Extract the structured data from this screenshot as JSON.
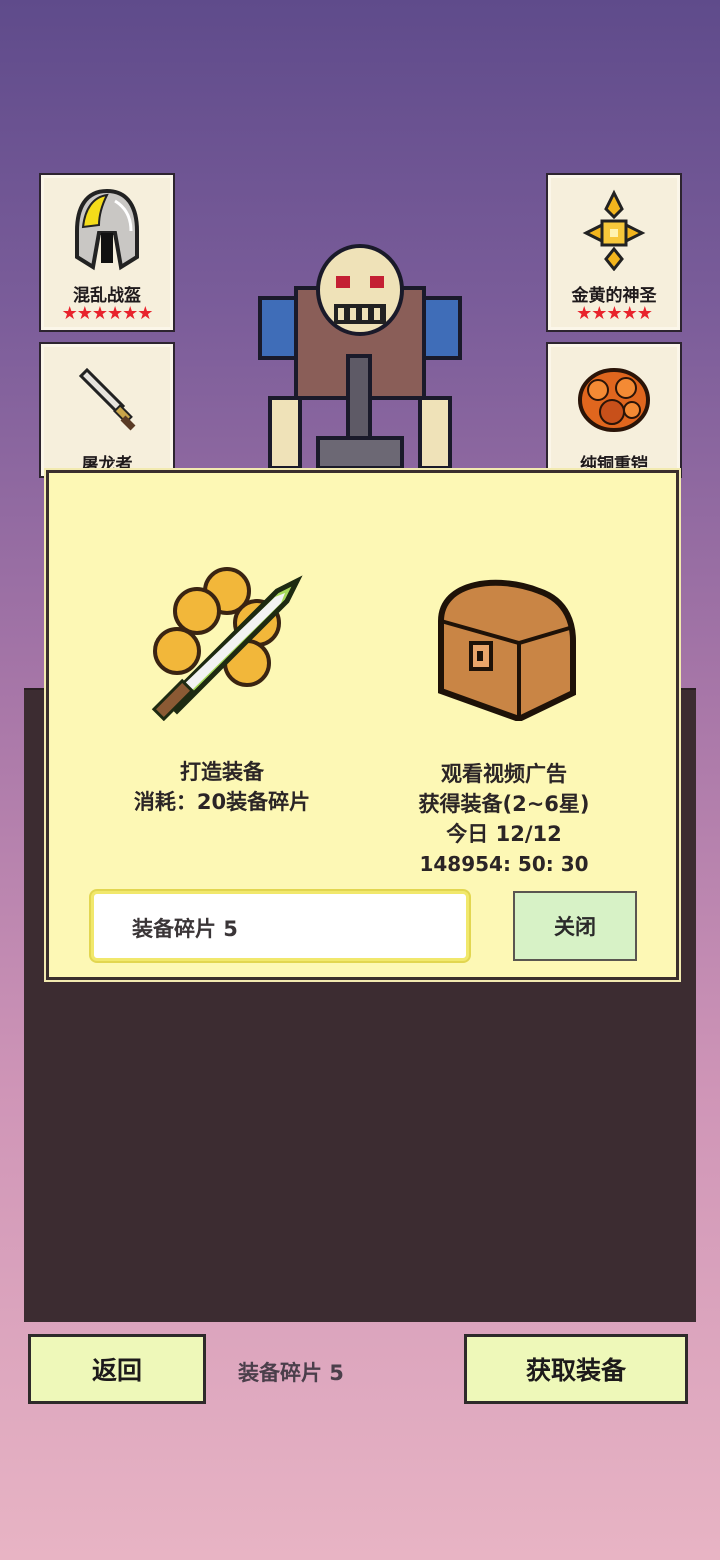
{
  "equipment_cards": [
    {
      "name": "混乱战盔",
      "stars": "★★★★★★",
      "icon": "helmet-icon"
    },
    {
      "name": "屠龙者",
      "stars": "",
      "icon": "dagger-icon"
    },
    {
      "name": "金黄的神圣",
      "stars": "★★★★★",
      "icon": "golden-cross-icon"
    },
    {
      "name": "纯铜重铠",
      "stars": "",
      "icon": "copper-armor-icon"
    }
  ],
  "dialog": {
    "craft": {
      "title": "打造装备",
      "cost": "消耗：20装备碎片",
      "icon": "sword-coins-icon"
    },
    "video": {
      "title": "观看视频广告",
      "reward": "获得装备(2~6星)",
      "daily": "今日 12/12",
      "timer": "148954: 50: 30",
      "icon": "treasure-chest-icon"
    },
    "fragments_label": "装备碎片  5",
    "close_label": "关闭"
  },
  "bottom_bar": {
    "back_label": "返回",
    "fragments_label": "装备碎片  5",
    "get_equipment_label": "获取装备"
  },
  "colors": {
    "dialog_bg": "#fdf8b5",
    "button_bg": "#eef8b9",
    "close_bg": "#d7f2c6",
    "star_red": "#e8232c"
  }
}
